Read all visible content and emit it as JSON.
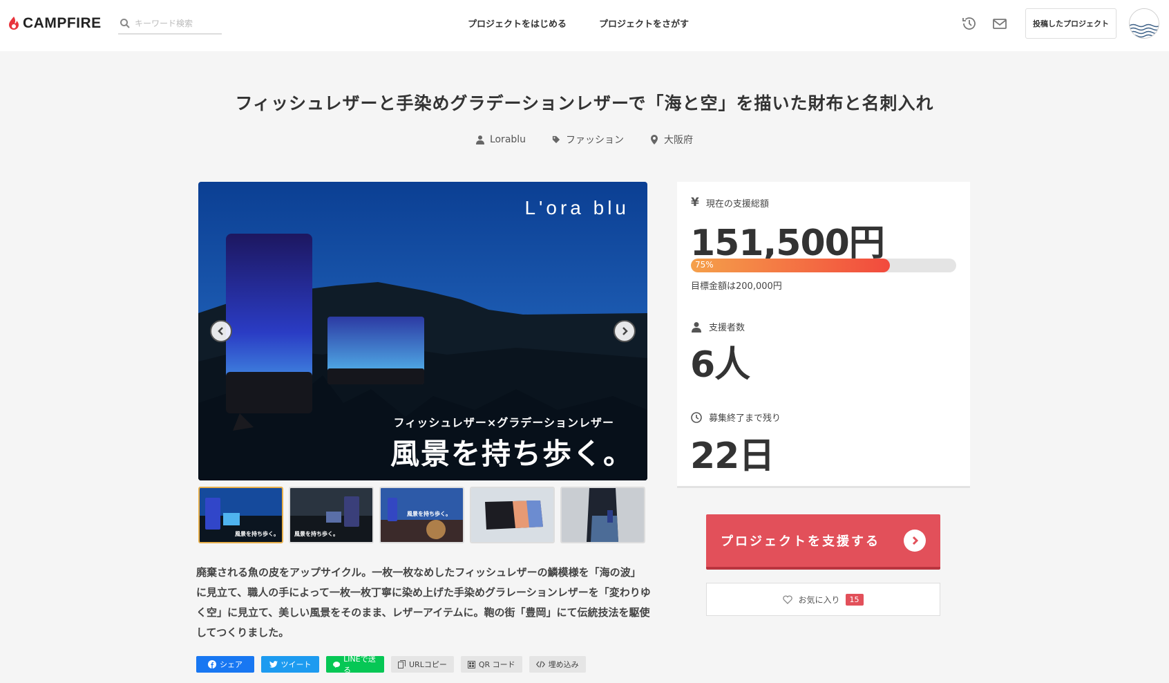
{
  "header": {
    "logo": "CAMPFIRE",
    "search_placeholder": "キーワード検索",
    "nav": [
      "プロジェクトをはじめる",
      "プロジェクトをさがす"
    ],
    "posted_projects": "投稿したプロジェクト"
  },
  "project": {
    "title": "フィッシュレザーと手染めグラデーションレザーで「海と空」を描いた財布と名刺入れ",
    "owner": "Lorablu",
    "category": "ファッション",
    "location": "大阪府",
    "image": {
      "brand": "L'ora blu",
      "subcopy": "フィッシュレザー×グラデーションレザー",
      "copy": "風景を持ち歩く。"
    },
    "thumb_copy": "風景を持ち歩く。",
    "description": "廃棄される魚の皮をアップサイクル。一枚一枚なめしたフィッシュレザーの鱗模様を「海の波」に見立て、職人の手によって一枚一枚丁寧に染め上げた手染めグラレーションレザーを「変わりゆく空」に見立て、美しい風景をそのまま、レザーアイテムに。鞄の街「豊岡」にて伝統技法を駆使してつくりました。"
  },
  "share": {
    "facebook": "シェア",
    "twitter": "ツイート",
    "line": "LINEで送る",
    "url_copy": "URLコピー",
    "qr": "QR コード",
    "embed": "埋め込み"
  },
  "stats": {
    "total_label": "現在の支援総額",
    "total_value": "151,500円",
    "progress_percent": 75,
    "progress_label": "75%",
    "goal": "目標金額は200,000円",
    "backers_label": "支援者数",
    "backers_value": "6人",
    "remaining_label": "募集終了まで残り",
    "remaining_value": "22日"
  },
  "actions": {
    "support": "プロジェクトを支援する",
    "favorite": "お気に入り",
    "favorite_count": "15"
  },
  "colors": {
    "accent": "#e2505a",
    "progress_start": "#f5a04a",
    "progress_end": "#f24a3d"
  }
}
